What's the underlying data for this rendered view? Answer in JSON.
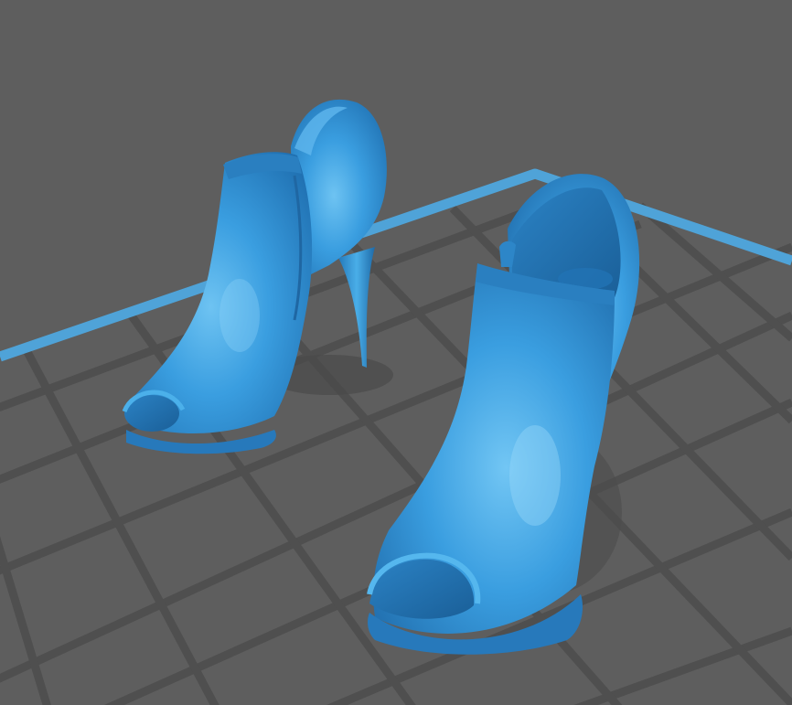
{
  "viewport": {
    "background_color": "#5e5e5e",
    "grid_line_color": "#4f4f4f",
    "bed_edge_color": "#4fa3d8",
    "model_color": "#2f8fd6",
    "model_highlight_color": "#6ec3f2",
    "model_shadow_color": "#1c5d96"
  },
  "objects": [
    {
      "name": "left-ankle-boot",
      "type": "3d-model"
    },
    {
      "name": "right-ankle-boot",
      "type": "3d-model"
    }
  ]
}
